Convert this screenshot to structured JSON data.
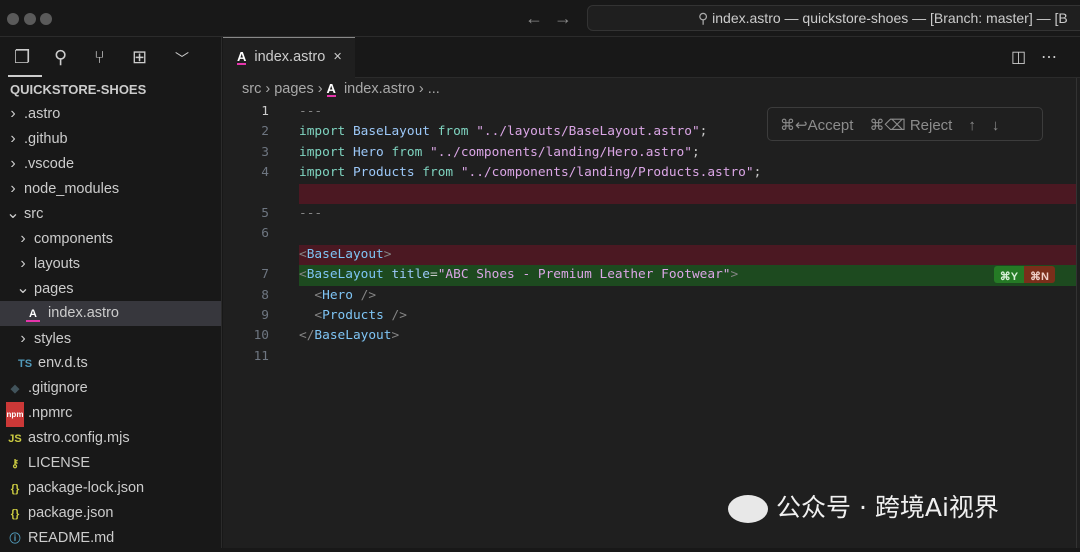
{
  "window": {
    "title": "index.astro — quickstore-shoes — [Branch: master] — [B"
  },
  "activity": {
    "icons": [
      "files-icon",
      "search-icon",
      "source-control-icon",
      "extensions-icon",
      "chevron-down-icon"
    ]
  },
  "explorer": {
    "project": "QUICKSTORE-SHOES",
    "items": [
      {
        "label": ".astro",
        "type": "folder",
        "depth": 0,
        "open": false
      },
      {
        "label": ".github",
        "type": "folder",
        "depth": 0,
        "open": false
      },
      {
        "label": ".vscode",
        "type": "folder",
        "depth": 0,
        "open": false
      },
      {
        "label": "node_modules",
        "type": "folder",
        "depth": 0,
        "open": false
      },
      {
        "label": "src",
        "type": "folder",
        "depth": 0,
        "open": true
      },
      {
        "label": "components",
        "type": "folder",
        "depth": 1,
        "open": false
      },
      {
        "label": "layouts",
        "type": "folder",
        "depth": 1,
        "open": false
      },
      {
        "label": "pages",
        "type": "folder",
        "depth": 1,
        "open": true
      },
      {
        "label": "index.astro",
        "type": "file",
        "depth": 2,
        "icon": "A",
        "iconColor": "#ffffff",
        "selected": true
      },
      {
        "label": "styles",
        "type": "folder",
        "depth": 1,
        "open": false
      },
      {
        "label": "env.d.ts",
        "type": "file",
        "depth": 1,
        "icon": "TS",
        "iconColor": "#519aba"
      },
      {
        "label": ".gitignore",
        "type": "file",
        "depth": 0,
        "icon": "◆",
        "iconColor": "#41535b"
      },
      {
        "label": ".npmrc",
        "type": "file",
        "depth": 0,
        "icon": "npm",
        "iconColor": "#cb3837"
      },
      {
        "label": "astro.config.mjs",
        "type": "file",
        "depth": 0,
        "icon": "JS",
        "iconColor": "#cbcb41"
      },
      {
        "label": "LICENSE",
        "type": "file",
        "depth": 0,
        "icon": "⚷",
        "iconColor": "#cbcb41"
      },
      {
        "label": "package-lock.json",
        "type": "file",
        "depth": 0,
        "icon": "{}",
        "iconColor": "#cbcb41"
      },
      {
        "label": "package.json",
        "type": "file",
        "depth": 0,
        "icon": "{}",
        "iconColor": "#cbcb41"
      },
      {
        "label": "README.md",
        "type": "file",
        "depth": 0,
        "icon": "ⓘ",
        "iconColor": "#519aba"
      }
    ]
  },
  "tab": {
    "label": "index.astro",
    "close": "×"
  },
  "breadcrumb": [
    "src",
    "pages",
    "index.astro",
    "..."
  ],
  "inline_diff": {
    "accept": "⌘↩Accept",
    "reject": "⌘⌫ Reject",
    "up": "↑",
    "down": "↓",
    "accept_key": "⌘Y",
    "reject_key": "⌘N"
  },
  "code": [
    {
      "n": "1",
      "kind": "normal",
      "cur": true,
      "tokens": [
        [
          "g",
          "---"
        ]
      ]
    },
    {
      "n": "2",
      "kind": "normal",
      "tokens": [
        [
          "k",
          "import "
        ],
        [
          "i",
          "BaseLayout "
        ],
        [
          "k",
          "from "
        ],
        [
          "s",
          "\"../layouts/BaseLayout.astro\""
        ],
        [
          "p",
          ";"
        ]
      ]
    },
    {
      "n": "3",
      "kind": "normal",
      "tokens": [
        [
          "k",
          "import "
        ],
        [
          "i",
          "Hero "
        ],
        [
          "k",
          "from "
        ],
        [
          "s",
          "\"../components/landing/Hero.astro\""
        ],
        [
          "p",
          ";"
        ]
      ]
    },
    {
      "n": "4",
      "kind": "normal",
      "tokens": [
        [
          "k",
          "import "
        ],
        [
          "i",
          "Products "
        ],
        [
          "k",
          "from "
        ],
        [
          "s",
          "\"../components/landing/Products.astro\""
        ],
        [
          "p",
          ";"
        ]
      ]
    },
    {
      "n": "",
      "kind": "del",
      "tokens": []
    },
    {
      "n": "5",
      "kind": "normal",
      "tokens": [
        [
          "g",
          "---"
        ]
      ]
    },
    {
      "n": "6",
      "kind": "normal",
      "tokens": []
    },
    {
      "n": "",
      "kind": "del",
      "tokens": [
        [
          "g",
          "<"
        ],
        [
          "t",
          "BaseLayout"
        ],
        [
          "g",
          ">"
        ]
      ]
    },
    {
      "n": "7",
      "kind": "add",
      "tokens": [
        [
          "g",
          "<"
        ],
        [
          "t",
          "BaseLayout "
        ],
        [
          "a",
          "title"
        ],
        [
          "p",
          "="
        ],
        [
          "s",
          "\"ABC Shoes - Premium Leather Footwear\""
        ],
        [
          "g",
          ">"
        ]
      ]
    },
    {
      "n": "8",
      "kind": "normal",
      "tokens": [
        [
          "p",
          "  "
        ],
        [
          "g",
          "<"
        ],
        [
          "t",
          "Hero "
        ],
        [
          "g",
          "/>"
        ]
      ]
    },
    {
      "n": "9",
      "kind": "normal",
      "tokens": [
        [
          "p",
          "  "
        ],
        [
          "g",
          "<"
        ],
        [
          "t",
          "Products "
        ],
        [
          "g",
          "/>"
        ]
      ]
    },
    {
      "n": "10",
      "kind": "normal",
      "tokens": [
        [
          "g",
          "</"
        ],
        [
          "t",
          "BaseLayout"
        ],
        [
          "g",
          ">"
        ]
      ]
    },
    {
      "n": "11",
      "kind": "normal",
      "tokens": []
    }
  ],
  "watermark": "公众号 · 跨境Ai视界"
}
